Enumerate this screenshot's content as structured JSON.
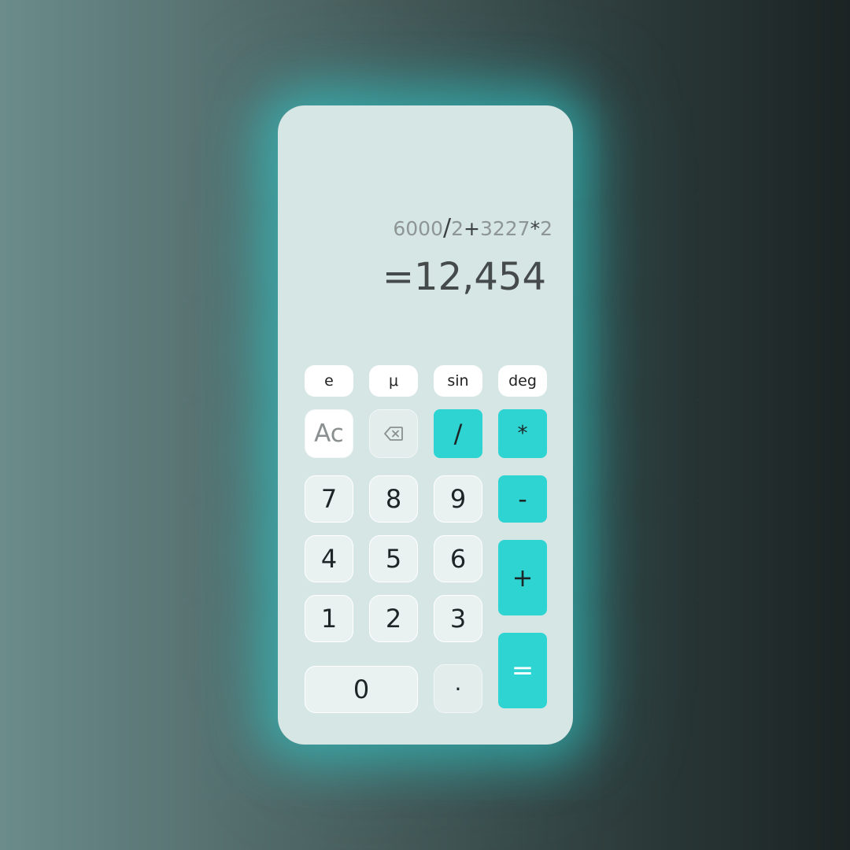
{
  "display": {
    "expression_parts": [
      "6000",
      "/",
      "2",
      "+",
      "3227",
      "*",
      "2"
    ],
    "result": "=12,454"
  },
  "function_row": [
    "e",
    "μ",
    "sin",
    "deg"
  ],
  "keys": {
    "clear": "Ac",
    "backspace_icon": "backspace-icon",
    "divide": "/",
    "multiply": "*",
    "minus": "-",
    "plus": "+",
    "equals": "=",
    "dot": "·",
    "digits": {
      "seven": "7",
      "eight": "8",
      "nine": "9",
      "four": "4",
      "five": "5",
      "six": "6",
      "one": "1",
      "two": "2",
      "three": "3",
      "zero": "0"
    }
  },
  "colors": {
    "accent": "#2dd4d2",
    "panel": "#d6e6e5",
    "glow": "#30d2d2"
  }
}
